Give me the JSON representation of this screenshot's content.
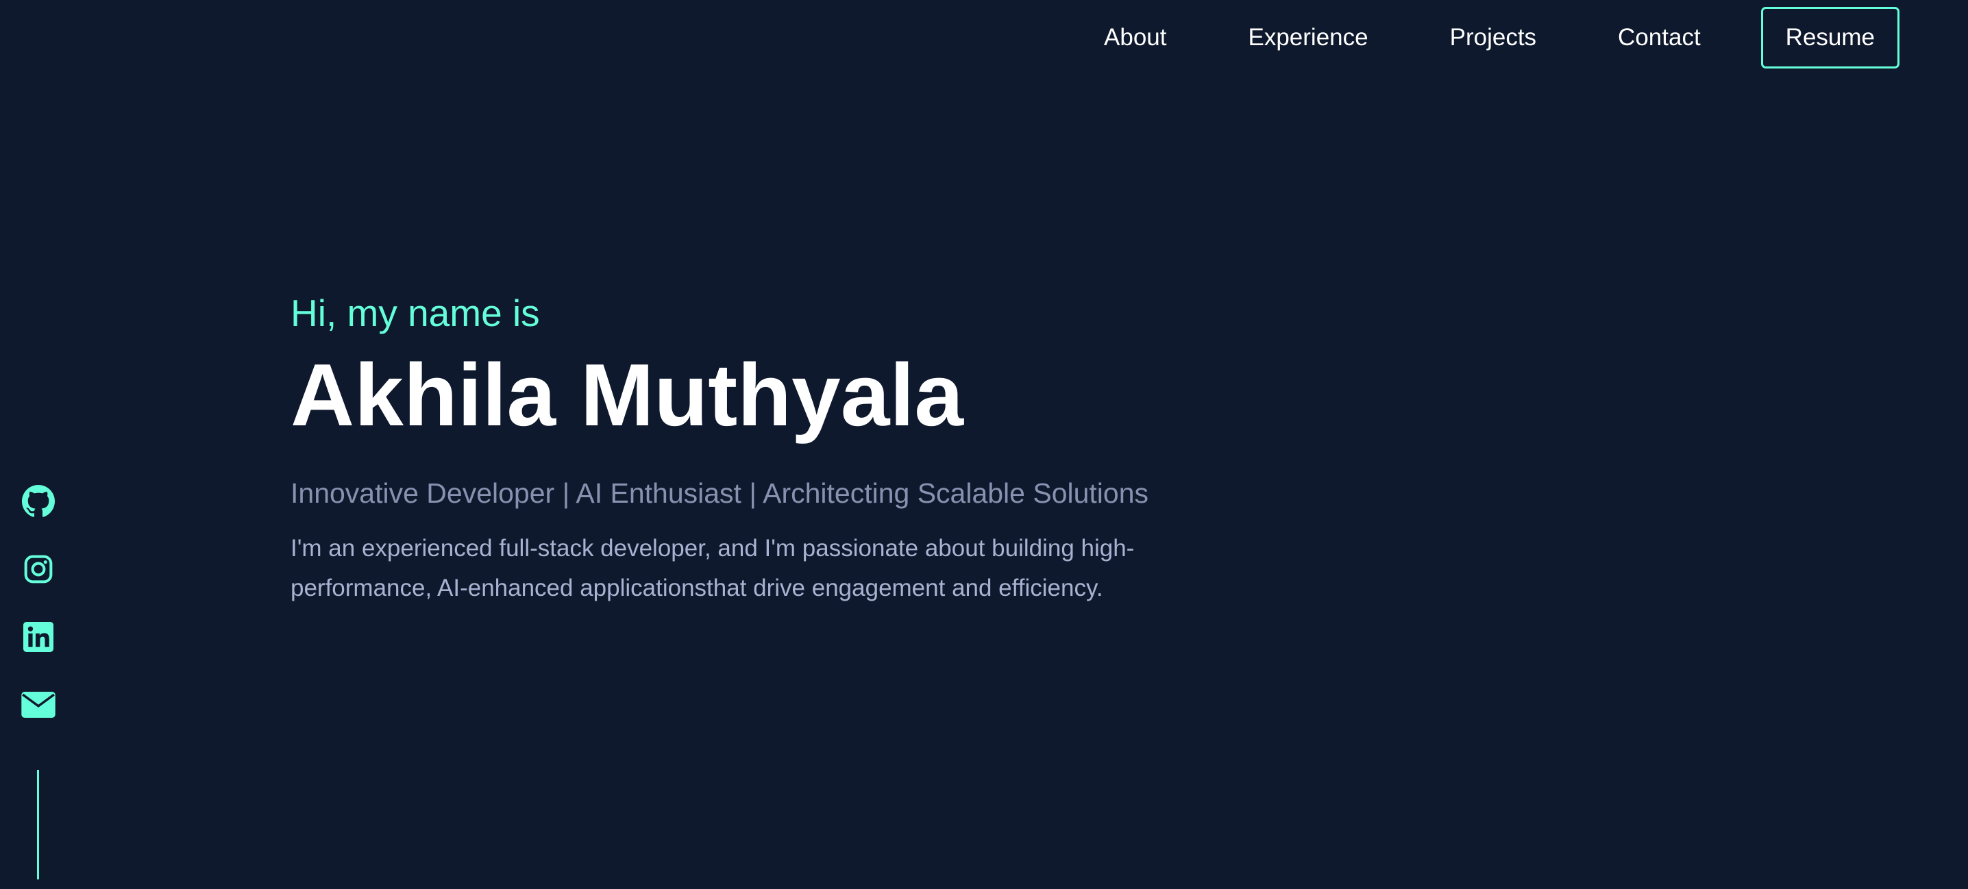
{
  "nav": {
    "items": [
      {
        "label": "About"
      },
      {
        "label": "Experience"
      },
      {
        "label": "Projects"
      },
      {
        "label": "Contact"
      }
    ],
    "resume_label": "Resume"
  },
  "social": {
    "icons": [
      "github-icon",
      "instagram-icon",
      "linkedin-icon",
      "email-icon"
    ]
  },
  "hero": {
    "greeting": "Hi, my name is",
    "name": "Akhila Muthyala",
    "tagline": "Innovative Developer | AI Enthusiast | Architecting Scalable Solutions",
    "intro": "I'm an experienced full-stack developer, and I'm passionate about building high-performance, AI-enhanced applicationsthat drive engagement and efficiency."
  },
  "colors": {
    "background": "#0f192d",
    "accent": "#64ffda",
    "heading": "#ffffff",
    "muted": "#8892b0",
    "body_text": "#a8b2d1"
  }
}
